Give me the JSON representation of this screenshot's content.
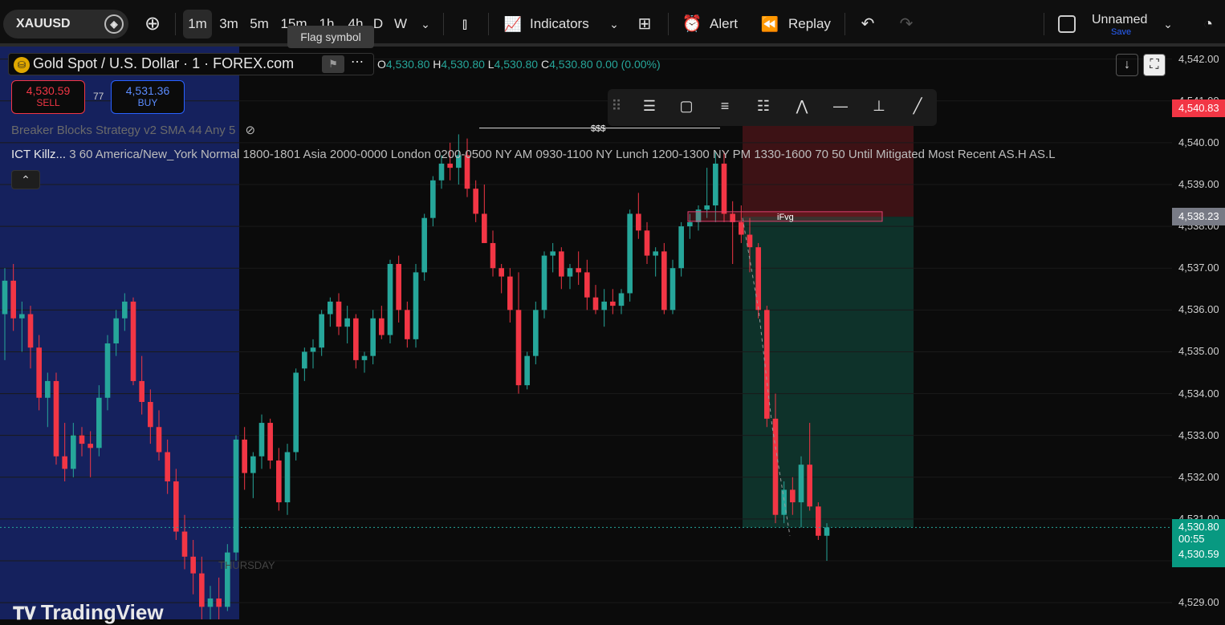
{
  "toolbar": {
    "symbol": "XAUUSD",
    "intervals": [
      "1m",
      "3m",
      "5m",
      "15m",
      "1h",
      "4h",
      "D",
      "W"
    ],
    "active_interval": "1m",
    "indicators_label": "Indicators",
    "alert_label": "Alert",
    "replay_label": "Replay",
    "layout_name": "Unnamed",
    "layout_save": "Save",
    "tooltip": "Flag symbol"
  },
  "legend": {
    "title": "Gold Spot / U.S. Dollar · 1 · FOREX.com",
    "coin_glyph": "⛁",
    "ohlc": {
      "o": "4,530.80",
      "h": "4,530.80",
      "l": "4,530.80",
      "c": "4,530.80",
      "chg": "0.00 (0.00%)"
    },
    "sell_price": "4,530.59",
    "sell_label": "SELL",
    "buy_price": "4,531.36",
    "buy_label": "BUY",
    "spread": "77",
    "indicator1": "Breaker Blocks Strategy v2 SMA 44 Any 5",
    "indicator2_name": "ICT Killz...",
    "indicator2_params": "3 60 America/New_York Normal 1800-1801 Asia 2000-0000 London 0200-0500 NY AM 0930-1100 NY Lunch 1200-1300 NY PM 1330-1600 70 50 Until Mitigated Most Recent AS.H AS.L"
  },
  "annotations": {
    "liquidity": "$$$",
    "ifvg": "iFvg",
    "day": "THURSDAY",
    "brand": "TradingView"
  },
  "price_axis": {
    "ticks": [
      "4,542.00",
      "4,541.00",
      "4,540.00",
      "4,539.00",
      "4,538.00",
      "4,537.00",
      "4,536.00",
      "4,535.00",
      "4,534.00",
      "4,533.00",
      "4,532.00",
      "4,531.00",
      "4,530.00",
      "4,529.00"
    ],
    "stop_label": "4,540.83",
    "entry_label": "4,538.23",
    "last_price": "4,530.80",
    "countdown": "00:55",
    "bid_label": "4,530.59"
  },
  "colors": {
    "up": "#26a69a",
    "down": "#f23645",
    "session": "#1a2a7a",
    "stop_zone": "#4a1418",
    "target_zone": "#0f3a30"
  },
  "chart_data": {
    "type": "candlestick",
    "ylim": [
      4528.6,
      4542.3
    ],
    "candles": [
      [
        4535.9,
        4537.0,
        4534.8,
        4536.7
      ],
      [
        4536.7,
        4537.1,
        4535.5,
        4535.8
      ],
      [
        4535.8,
        4536.2,
        4535.0,
        4535.9
      ],
      [
        4535.9,
        4536.1,
        4534.6,
        4535.1
      ],
      [
        4535.1,
        4535.4,
        4533.6,
        4533.9
      ],
      [
        4533.9,
        4534.5,
        4533.2,
        4534.3
      ],
      [
        4534.3,
        4534.5,
        4532.3,
        4532.5
      ],
      [
        4532.5,
        4533.3,
        4531.9,
        4532.2
      ],
      [
        4532.2,
        4533.3,
        4532.0,
        4533.0
      ],
      [
        4533.0,
        4533.2,
        4532.5,
        4532.8
      ],
      [
        4532.8,
        4533.1,
        4532.0,
        4532.7
      ],
      [
        4532.7,
        4534.2,
        4532.5,
        4533.9
      ],
      [
        4533.9,
        4535.4,
        4533.6,
        4535.2
      ],
      [
        4535.2,
        4536.0,
        4534.9,
        4535.8
      ],
      [
        4535.8,
        4536.4,
        4535.5,
        4536.2
      ],
      [
        4536.2,
        4536.3,
        4534.2,
        4534.3
      ],
      [
        4534.3,
        4534.9,
        4533.5,
        4533.8
      ],
      [
        4533.8,
        4534.1,
        4532.8,
        4533.2
      ],
      [
        4533.2,
        4533.6,
        4532.4,
        4532.6
      ],
      [
        4532.6,
        4532.9,
        4531.6,
        4531.9
      ],
      [
        4531.9,
        4532.2,
        4530.5,
        4530.7
      ],
      [
        4530.7,
        4531.1,
        4529.8,
        4530.1
      ],
      [
        4530.1,
        4530.5,
        4529.2,
        4529.7
      ],
      [
        4529.7,
        4530.1,
        4528.6,
        4528.9
      ],
      [
        4528.9,
        4529.4,
        4528.4,
        4529.1
      ],
      [
        4529.1,
        4529.6,
        4528.5,
        4528.9
      ],
      [
        4528.9,
        4530.4,
        4528.8,
        4530.2
      ],
      [
        4530.2,
        4533.0,
        4530.0,
        4532.9
      ],
      [
        4532.9,
        4533.2,
        4531.7,
        4532.1
      ],
      [
        4532.1,
        4532.6,
        4531.5,
        4532.5
      ],
      [
        4532.5,
        4533.5,
        4532.2,
        4533.3
      ],
      [
        4533.3,
        4533.4,
        4532.2,
        4532.4
      ],
      [
        4532.4,
        4532.7,
        4531.2,
        4531.4
      ],
      [
        4531.4,
        4532.8,
        4531.1,
        4532.6
      ],
      [
        4532.6,
        4534.6,
        4532.4,
        4534.5
      ],
      [
        4534.6,
        4535.1,
        4534.3,
        4535.0
      ],
      [
        4535.0,
        4535.3,
        4534.6,
        4535.1
      ],
      [
        4535.1,
        4536.0,
        4534.9,
        4535.9
      ],
      [
        4535.9,
        4536.3,
        4535.6,
        4536.2
      ],
      [
        4536.2,
        4536.4,
        4535.4,
        4535.6
      ],
      [
        4535.6,
        4536.1,
        4535.2,
        4535.8
      ],
      [
        4535.8,
        4535.9,
        4534.6,
        4534.8
      ],
      [
        4534.8,
        4535.0,
        4534.5,
        4534.9
      ],
      [
        4534.9,
        4536.0,
        4534.7,
        4535.8
      ],
      [
        4535.8,
        4536.1,
        4535.3,
        4535.4
      ],
      [
        4535.4,
        4537.2,
        4535.2,
        4537.1
      ],
      [
        4537.1,
        4537.3,
        4535.7,
        4536.0
      ],
      [
        4536.0,
        4536.2,
        4535.1,
        4535.3
      ],
      [
        4535.3,
        4537.1,
        4535.1,
        4536.9
      ],
      [
        4536.9,
        4538.3,
        4536.7,
        4538.2
      ],
      [
        4538.2,
        4539.2,
        4538.0,
        4539.1
      ],
      [
        4539.1,
        4539.7,
        4538.9,
        4539.5
      ],
      [
        4539.5,
        4540.0,
        4539.1,
        4539.4
      ],
      [
        4539.4,
        4540.2,
        4539.0,
        4539.7
      ],
      [
        4539.7,
        4540.1,
        4538.7,
        4538.9
      ],
      [
        4538.9,
        4539.1,
        4538.1,
        4538.3
      ],
      [
        4538.3,
        4539.0,
        4537.6,
        4537.6
      ],
      [
        4537.6,
        4537.9,
        4536.8,
        4537.0
      ],
      [
        4537.0,
        4537.1,
        4536.4,
        4536.8
      ],
      [
        4536.8,
        4537.0,
        4535.7,
        4536.0
      ],
      [
        4536.0,
        4536.9,
        4534.0,
        4534.2
      ],
      [
        4534.2,
        4535.0,
        4534.1,
        4534.9
      ],
      [
        4534.9,
        4536.2,
        4534.7,
        4536.0
      ],
      [
        4536.0,
        4537.4,
        4535.8,
        4537.3
      ],
      [
        4537.3,
        4537.6,
        4536.9,
        4537.4
      ],
      [
        4537.4,
        4537.5,
        4536.5,
        4536.8
      ],
      [
        4536.8,
        4537.1,
        4536.5,
        4537.0
      ],
      [
        4537.0,
        4537.4,
        4536.6,
        4536.9
      ],
      [
        4536.9,
        4537.2,
        4536.0,
        4536.3
      ],
      [
        4536.3,
        4536.6,
        4535.9,
        4536.0
      ],
      [
        4536.0,
        4536.5,
        4535.6,
        4536.2
      ],
      [
        4536.2,
        4536.5,
        4535.9,
        4536.1
      ],
      [
        4536.1,
        4536.5,
        4535.9,
        4536.4
      ],
      [
        4536.4,
        4538.4,
        4536.2,
        4538.3
      ],
      [
        4538.3,
        4538.8,
        4537.7,
        4537.9
      ],
      [
        4537.9,
        4538.1,
        4537.1,
        4537.3
      ],
      [
        4537.3,
        4537.5,
        4536.8,
        4537.4
      ],
      [
        4537.4,
        4537.6,
        4535.9,
        4536.0
      ],
      [
        4536.0,
        4537.2,
        4535.9,
        4537.0
      ],
      [
        4537.0,
        4538.1,
        4536.8,
        4538.0
      ],
      [
        4538.0,
        4538.3,
        4537.7,
        4538.1
      ],
      [
        4538.1,
        4538.5,
        4537.9,
        4538.4
      ],
      [
        4538.4,
        4539.4,
        4538.2,
        4538.5
      ],
      [
        4538.5,
        4539.8,
        4538.1,
        4539.5
      ],
      [
        4539.5,
        4539.8,
        4538.1,
        4538.3
      ],
      [
        4538.3,
        4538.6,
        4537.1,
        4538.1
      ],
      [
        4538.1,
        4538.5,
        4537.6,
        4537.8
      ],
      [
        4537.8,
        4538.2,
        4536.9,
        4537.5
      ],
      [
        4537.5,
        4537.6,
        4535.8,
        4536.0
      ],
      [
        4536.0,
        4536.1,
        4533.2,
        4533.4
      ],
      [
        4533.4,
        4534.0,
        4530.9,
        4531.1
      ],
      [
        4531.1,
        4531.9,
        4530.9,
        4531.7
      ],
      [
        4531.7,
        4532.0,
        4531.1,
        4531.4
      ],
      [
        4531.4,
        4532.5,
        4530.8,
        4532.3
      ],
      [
        4532.3,
        4533.3,
        4531.2,
        4531.3
      ],
      [
        4531.3,
        4531.4,
        4530.5,
        4530.6
      ],
      [
        4530.6,
        4530.9,
        4530.0,
        4530.8
      ]
    ]
  }
}
